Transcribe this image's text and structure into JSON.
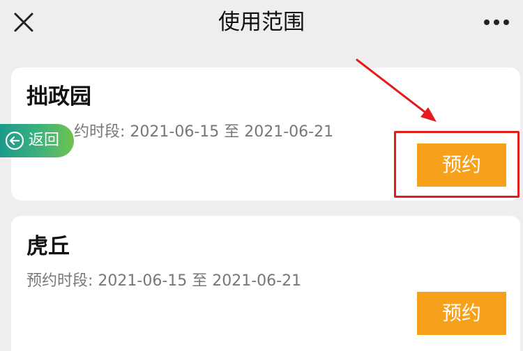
{
  "header": {
    "title": "使用范围",
    "close_icon": "close-icon",
    "more_icon": "more-icon"
  },
  "cards": [
    {
      "name": "拙政园",
      "period_prefix": "约时段: ",
      "period": "2021-06-15 至 2021-06-21",
      "button_label": "预约"
    },
    {
      "name": "虎丘",
      "period_prefix": "预约时段: ",
      "period": "2021-06-15 至 2021-06-21",
      "button_label": "预约"
    }
  ],
  "back_button": {
    "label": "返回",
    "icon": "arrow-left-circle-icon"
  },
  "annotation": {
    "highlight_color": "#e21b1b"
  },
  "colors": {
    "accent": "#f7a01b",
    "background": "#eeedf0",
    "back_gradient_start": "#1b9a8c",
    "back_gradient_end": "#6fc34f"
  }
}
